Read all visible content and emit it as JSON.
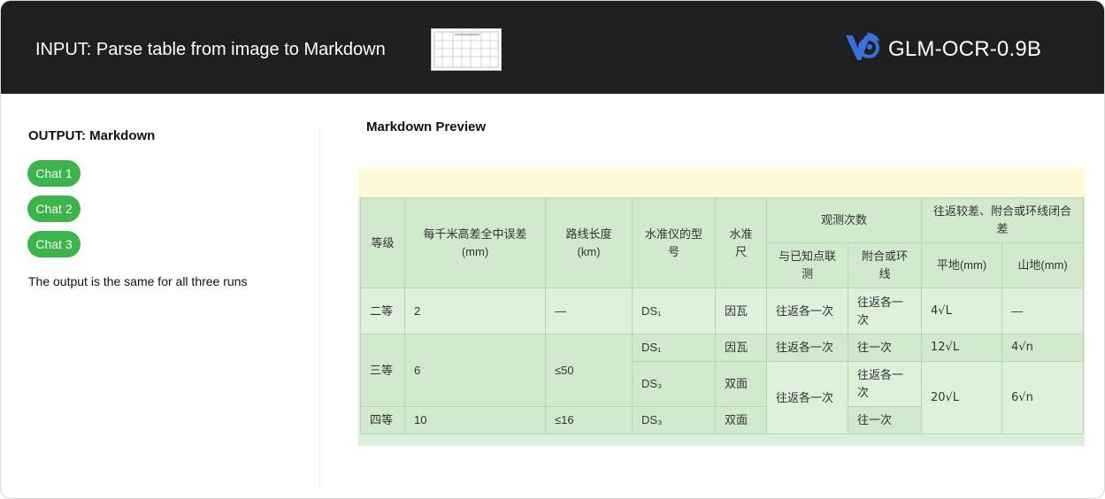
{
  "header": {
    "title": "INPUT: Parse table from image to Markdown",
    "brand": "GLM-OCR-0.9B"
  },
  "left": {
    "output_label": "OUTPUT: Markdown",
    "chats": [
      "Chat 1",
      "Chat 2",
      "Chat 3"
    ],
    "note": "The output is the same for all three runs"
  },
  "preview": {
    "title": "Markdown Preview",
    "table": {
      "headers": {
        "grade": "等级",
        "error": "每千米高差全中误差(mm)",
        "length": "路线长度(km)",
        "model": "水准仪的型号",
        "rod": "水准尺",
        "obs": "观测次数",
        "closure": "往返较差、附合或环线闭合差",
        "obs_known": "与已知点联测",
        "obs_loop": "附合或环线",
        "flat": "平地(mm)",
        "mountain": "山地(mm)"
      },
      "rows": [
        {
          "grade": "二等",
          "error": "2",
          "length": "—",
          "model": "DS₁",
          "rod": "因瓦",
          "obs_known": "往返各一次",
          "obs_loop": "往返各一次",
          "flat": "4√L",
          "mountain": "—"
        },
        {
          "grade": "三等",
          "error": "6",
          "length": "≤50",
          "model": "DS₁",
          "rod": "因瓦",
          "obs_known": "往返各一次",
          "obs_loop": "往一次",
          "flat": "12√L",
          "mountain": "4√n"
        },
        {
          "model": "DS₃",
          "rod": "双面",
          "obs_known": "往返各一次",
          "obs_loop": "往返各一次",
          "flat": "20√L",
          "mountain": "6√n"
        },
        {
          "grade": "四等",
          "error": "10",
          "length": "≤16",
          "model": "DS₃",
          "rod": "双面",
          "obs_loop": "往一次"
        }
      ]
    }
  },
  "colors": {
    "header_bg": "#1f1f1f",
    "chat_button": "#3bb54a",
    "table_bg": "#dbf0d9",
    "band": "#fdf8d6"
  }
}
